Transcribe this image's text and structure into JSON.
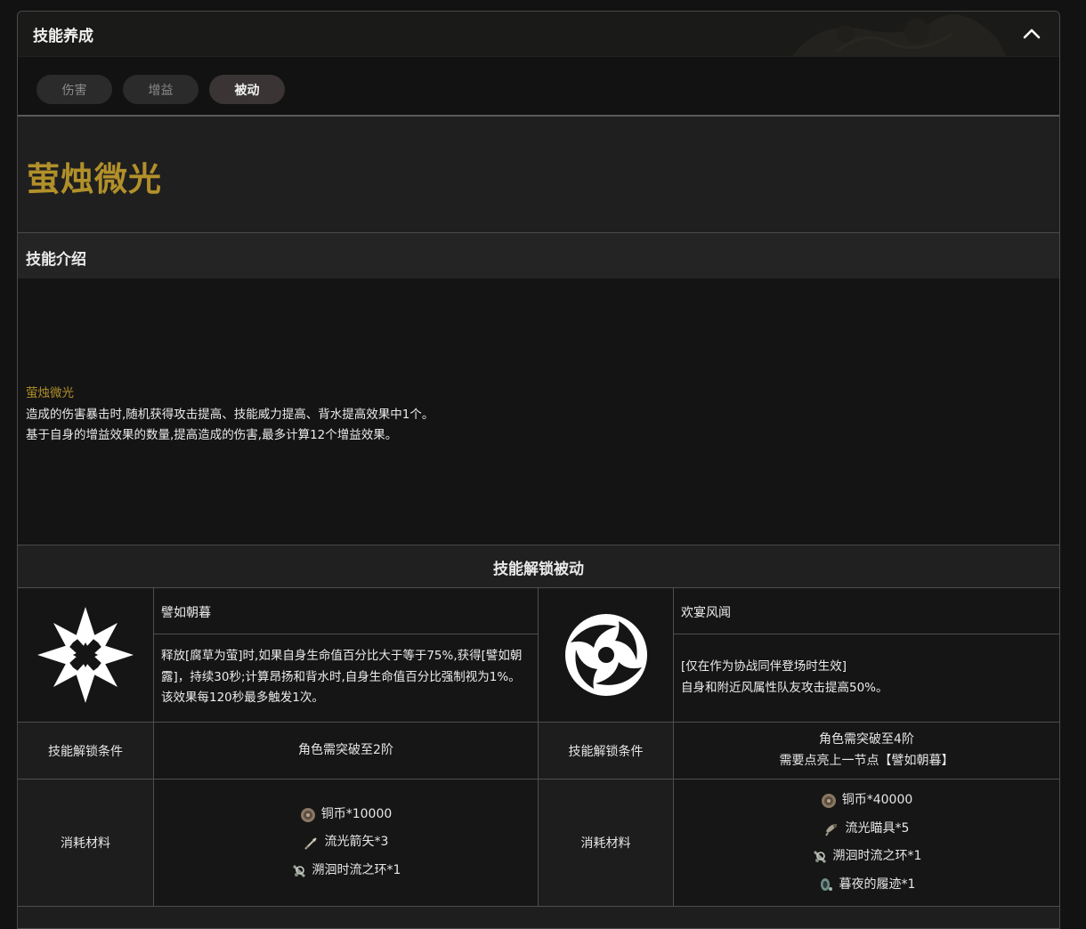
{
  "header": {
    "title": "技能养成"
  },
  "tabs": [
    {
      "label": "伤害",
      "active": false
    },
    {
      "label": "增益",
      "active": false
    },
    {
      "label": "被动",
      "active": true
    }
  ],
  "skill": {
    "name": "萤烛微光"
  },
  "intro": {
    "title": "技能介绍",
    "highlight": "萤烛微光",
    "lines": [
      "造成的伤害暴击时,随机获得攻击提高、技能威力提高、背水提高效果中1个。",
      "基于自身的增益效果的数量,提高造成的伤害,最多计算12个增益效果。"
    ]
  },
  "unlock": {
    "title": "技能解锁被动",
    "passives": [
      {
        "name": "譬如朝暮",
        "icon": "star-burst-icon",
        "desc": "释放[腐草为萤]时,如果自身生命值百分比大于等于75%,获得[譬如朝露]，持续30秒;计算昂扬和背水时,自身生命值百分比强制视为1%。该效果每120秒最多触发1次。",
        "cond_label": "技能解锁条件",
        "cond_lines": [
          "角色需突破至2阶"
        ],
        "mat_label": "消耗材料",
        "materials": [
          {
            "icon": "coin-icon",
            "text": "铜币*10000"
          },
          {
            "icon": "arrow-icon",
            "text": "流光箭矢*3"
          },
          {
            "icon": "ring-icon",
            "text": "溯洄时流之环*1"
          }
        ]
      },
      {
        "name": "欢宴风闻",
        "icon": "wind-swirl-icon",
        "desc_lines": [
          "[仅在作为协战同伴登场时生效]",
          "自身和附近风属性队友攻击提高50%。"
        ],
        "cond_label": "技能解锁条件",
        "cond_lines": [
          "角色需突破至4阶",
          "需要点亮上一节点【譬如朝暮】"
        ],
        "mat_label": "消耗材料",
        "materials": [
          {
            "icon": "coin-icon",
            "text": "铜币*40000"
          },
          {
            "icon": "scope-icon",
            "text": "流光瞄具*5"
          },
          {
            "icon": "ring-icon",
            "text": "溯洄时流之环*1"
          },
          {
            "icon": "footprint-icon",
            "text": "暮夜的履迹*1"
          }
        ]
      }
    ]
  }
}
